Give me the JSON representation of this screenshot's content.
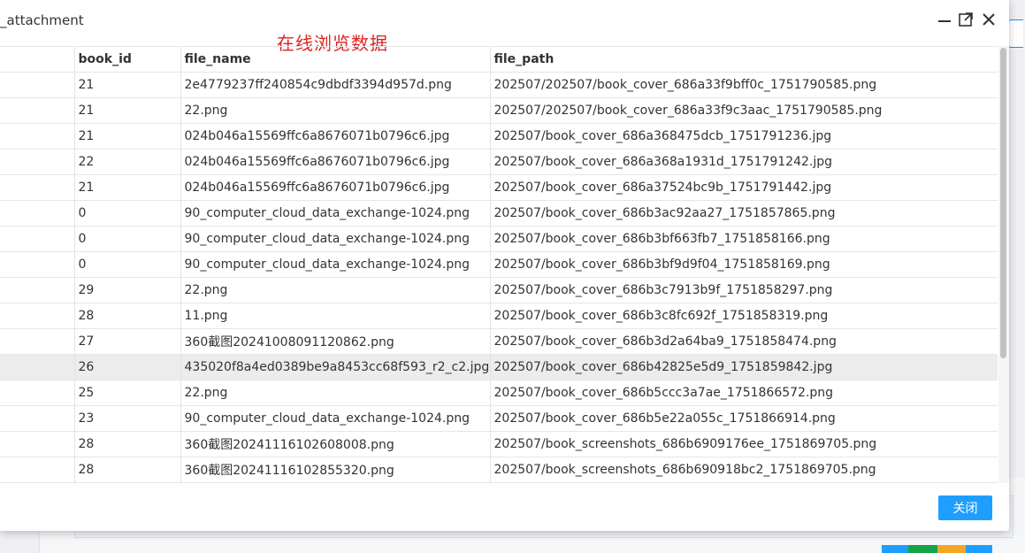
{
  "dialog": {
    "title": "_attachment",
    "overlay_text": "在线浏览数据",
    "controls": {
      "minimize": "minimize-icon",
      "maximize": "maximize-icon",
      "close": "close-icon"
    }
  },
  "table": {
    "columns": [
      "",
      "book_id",
      "file_name",
      "file_path"
    ],
    "rows": [
      {
        "id": "",
        "book_id": "21",
        "file_name": "2e4779237ff240854c9dbdf3394d957d.png",
        "file_path": "202507/202507/book_cover_686a33f9bff0c_1751790585.png"
      },
      {
        "id": "",
        "book_id": "21",
        "file_name": "22.png",
        "file_path": "202507/202507/book_cover_686a33f9c3aac_1751790585.png"
      },
      {
        "id": "",
        "book_id": "21",
        "file_name": "024b046a15569ffc6a8676071b0796c6.jpg",
        "file_path": "202507/book_cover_686a368475dcb_1751791236.jpg"
      },
      {
        "id": "",
        "book_id": "22",
        "file_name": "024b046a15569ffc6a8676071b0796c6.jpg",
        "file_path": "202507/book_cover_686a368a1931d_1751791242.jpg"
      },
      {
        "id": "",
        "book_id": "21",
        "file_name": "024b046a15569ffc6a8676071b0796c6.jpg",
        "file_path": "202507/book_cover_686a37524bc9b_1751791442.jpg"
      },
      {
        "id": "",
        "book_id": "0",
        "file_name": "90_computer_cloud_data_exchange-1024.png",
        "file_path": "202507/book_cover_686b3ac92aa27_1751857865.png"
      },
      {
        "id": "",
        "book_id": "0",
        "file_name": "90_computer_cloud_data_exchange-1024.png",
        "file_path": "202507/book_cover_686b3bf663fb7_1751858166.png"
      },
      {
        "id": "",
        "book_id": "0",
        "file_name": "90_computer_cloud_data_exchange-1024.png",
        "file_path": "202507/book_cover_686b3bf9d9f04_1751858169.png"
      },
      {
        "id": "",
        "book_id": "29",
        "file_name": "22.png",
        "file_path": "202507/book_cover_686b3c7913b9f_1751858297.png"
      },
      {
        "id": "",
        "book_id": "28",
        "file_name": "11.png",
        "file_path": "202507/book_cover_686b3c8fc692f_1751858319.png"
      },
      {
        "id": "",
        "book_id": "27",
        "file_name": "360截图20241008091120862.png",
        "file_path": "202507/book_cover_686b3d2a64ba9_1751858474.png"
      },
      {
        "id": "",
        "book_id": "26",
        "file_name": "435020f8a4ed0389be9a8453cc68f593_r2_c2.jpg",
        "file_path": "202507/book_cover_686b42825e5d9_1751859842.jpg"
      },
      {
        "id": "",
        "book_id": "25",
        "file_name": "22.png",
        "file_path": "202507/book_cover_686b5ccc3a7ae_1751866572.png"
      },
      {
        "id": "",
        "book_id": "23",
        "file_name": "90_computer_cloud_data_exchange-1024.png",
        "file_path": "202507/book_cover_686b5e22a055c_1751866914.png"
      },
      {
        "id": "",
        "book_id": "28",
        "file_name": "360截图20241116102608008.png",
        "file_path": "202507/book_screenshots_686b6909176ee_1751869705.png"
      },
      {
        "id": "",
        "book_id": "28",
        "file_name": "360截图20241116102855320.png",
        "file_path": "202507/book_screenshots_686b690918bc2_1751869705.png"
      }
    ],
    "selected_row": 11
  },
  "footer": {
    "close_label": "关闭"
  },
  "colors": {
    "accent": "#1e9fff",
    "overlay_text": "#e02020",
    "selected_row": "#ececec"
  }
}
